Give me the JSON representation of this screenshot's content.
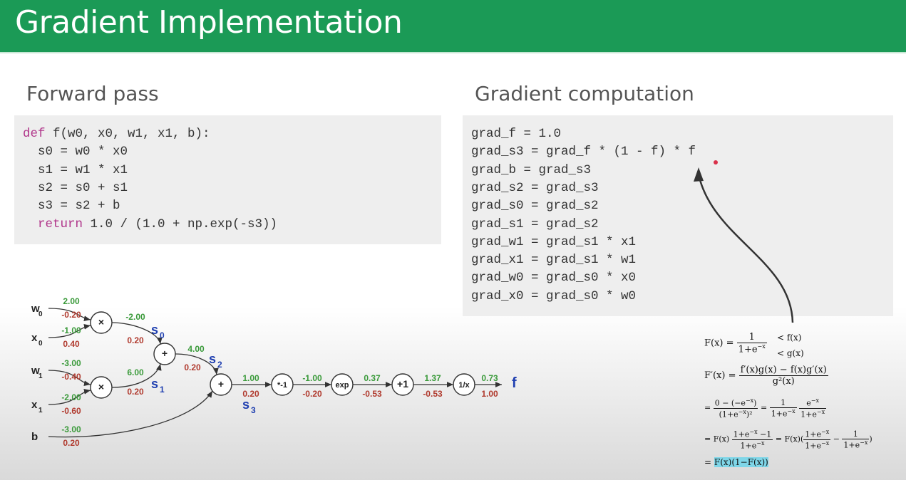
{
  "title": "Gradient Implementation",
  "forward": {
    "heading": "Forward pass",
    "code": [
      {
        "kw": "def",
        "text": " f(w0, x0, w1, x1, b):"
      },
      {
        "kw": "",
        "text": "  s0 = w0 * x0"
      },
      {
        "kw": "",
        "text": "  s1 = w1 * x1"
      },
      {
        "kw": "",
        "text": "  s2 = s0 + s1"
      },
      {
        "kw": "",
        "text": "  s3 = s2 + b"
      },
      {
        "kw": "  return",
        "text": " 1.0 / (1.0 + np.exp(-s3))"
      }
    ]
  },
  "gradient": {
    "heading": "Gradient computation",
    "code": [
      "grad_f = 1.0",
      "grad_s3 = grad_f * (1 - f) * f",
      "grad_b = grad_s3",
      "grad_s2 = grad_s3",
      "grad_s0 = grad_s2",
      "grad_s1 = grad_s2",
      "grad_w1 = grad_s1 * x1",
      "grad_x1 = grad_s1 * w1",
      "grad_w0 = grad_s0 * x0",
      "grad_x0 = grad_s0 * w0"
    ]
  },
  "graph": {
    "inputs": [
      {
        "name": "w",
        "sub": "0",
        "value": "2.00",
        "grad": "-0.20"
      },
      {
        "name": "x",
        "sub": "0",
        "value": "-1.00",
        "grad": "0.40"
      },
      {
        "name": "w",
        "sub": "1",
        "value": "-3.00",
        "grad": "-0.40"
      },
      {
        "name": "x",
        "sub": "1",
        "value": "-2.00",
        "grad": "-0.60"
      },
      {
        "name": "b",
        "sub": "",
        "value": "-3.00",
        "grad": "0.20"
      }
    ],
    "nodes": [
      "×",
      "×",
      "+",
      "+",
      "*-1",
      "exp",
      "+1",
      "1/x"
    ],
    "edges": [
      {
        "value": "-2.00",
        "grad": "0.20"
      },
      {
        "value": "6.00",
        "grad": "0.20"
      },
      {
        "value": "4.00",
        "grad": "0.20"
      },
      {
        "value": "1.00",
        "grad": "0.20"
      },
      {
        "value": "-1.00",
        "grad": "-0.20"
      },
      {
        "value": "0.37",
        "grad": "-0.53"
      },
      {
        "value": "1.37",
        "grad": "-0.53"
      },
      {
        "value": "0.73",
        "grad": "1.00"
      }
    ],
    "stage_labels": [
      {
        "name": "s",
        "sub": "0"
      },
      {
        "name": "s",
        "sub": "1"
      },
      {
        "name": "s",
        "sub": "2"
      },
      {
        "name": "s",
        "sub": "3"
      }
    ],
    "output_label": "f",
    "colors": {
      "value": "#3a9a3a",
      "grad": "#b03a2e",
      "stage": "#1f3fb0",
      "node_stroke": "#333333"
    }
  },
  "derivation": {
    "F_def": "F(x) =",
    "F_num": "1",
    "F_den": "1+e",
    "F_den_exp": "−x",
    "f_note": "< f(x)",
    "g_note": "< g(x)",
    "Fp_lhs": "F′(x) =",
    "Fp_num": "f′(x)g(x) − f(x)g′(x)",
    "Fp_den": "g²(x)",
    "line3": "=",
    "line3_num1": "0 − (−e",
    "line3_num1_tail": ")",
    "line3_den1": "(1+e",
    "line3_den1_tail": ")²",
    "line3_eq": "=",
    "line3_num2": "1",
    "line3_den2": "1+e",
    "line3_num3": "e",
    "line3_den3": "1+e",
    "line4_lhs": "= F(x)",
    "line4_num": "1+e",
    "line4_num_tail": " −1",
    "line4_den": "1+e",
    "line4_eq": "= F(x)(",
    "line4_num2": "1+e",
    "line4_den2": "1+e",
    "line4_minus": "−",
    "line4_num3": "1",
    "line4_den3": "1+e",
    "line4_close": ")",
    "final_eq": "=",
    "final": "F(x)(1−F(x))",
    "neg_x": "−x"
  }
}
